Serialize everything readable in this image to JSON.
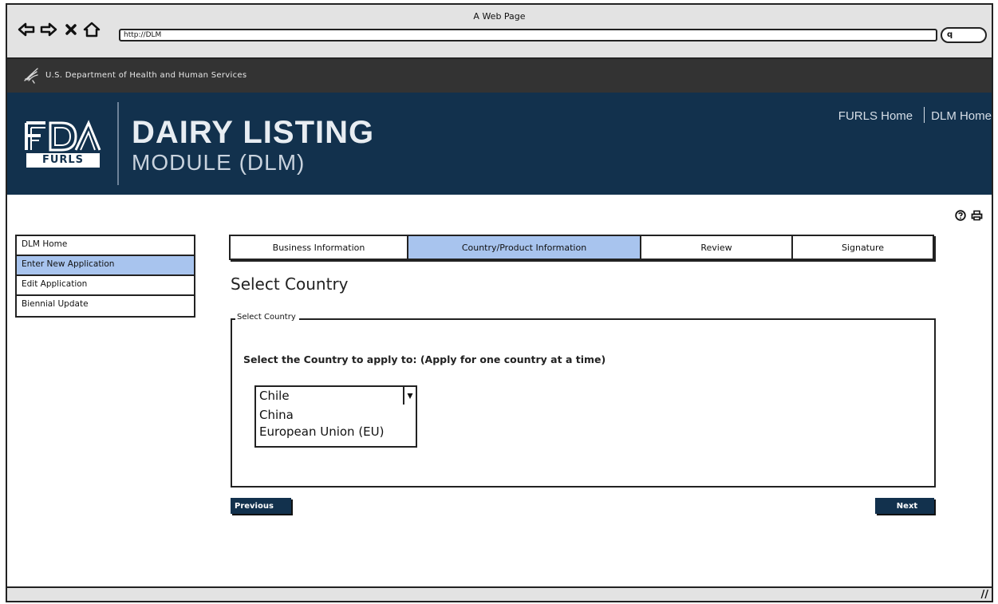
{
  "browser": {
    "title": "A Web Page",
    "url": "http://DLM",
    "nav_icons": [
      "back-icon",
      "forward-icon",
      "close-icon",
      "home-icon"
    ],
    "search_glyph": "q"
  },
  "agency_bar": {
    "text": "U.S. Department of Health and Human Services"
  },
  "header": {
    "logo_text": "FURLS",
    "title_line1": "DAIRY LISTING",
    "title_line2": "MODULE (DLM)",
    "links": [
      "FURLS Home",
      "DLM Home"
    ],
    "colors": {
      "header_bg": "#12314d",
      "agency_bg": "#333333",
      "highlight": "#a8c4ee"
    }
  },
  "sidebar": {
    "items": [
      {
        "label": "DLM Home",
        "active": false
      },
      {
        "label": "Enter New Application",
        "active": true
      },
      {
        "label": "Edit Application",
        "active": false
      },
      {
        "label": "Biennial Update",
        "active": false
      }
    ]
  },
  "tabs": [
    {
      "label": "Business Information",
      "active": false
    },
    {
      "label": "Country/Product Information",
      "active": true
    },
    {
      "label": "Review",
      "active": false
    },
    {
      "label": "Signature",
      "active": false
    }
  ],
  "main": {
    "page_title": "Select Country",
    "fieldset_legend": "Select Country",
    "prompt": "Select the Country to apply to: (Apply for one country at a time)",
    "country_select": {
      "selected": "Chile",
      "options": [
        "China",
        "European Union (EU)"
      ]
    }
  },
  "buttons": {
    "previous": "Previous",
    "next": "Next"
  }
}
